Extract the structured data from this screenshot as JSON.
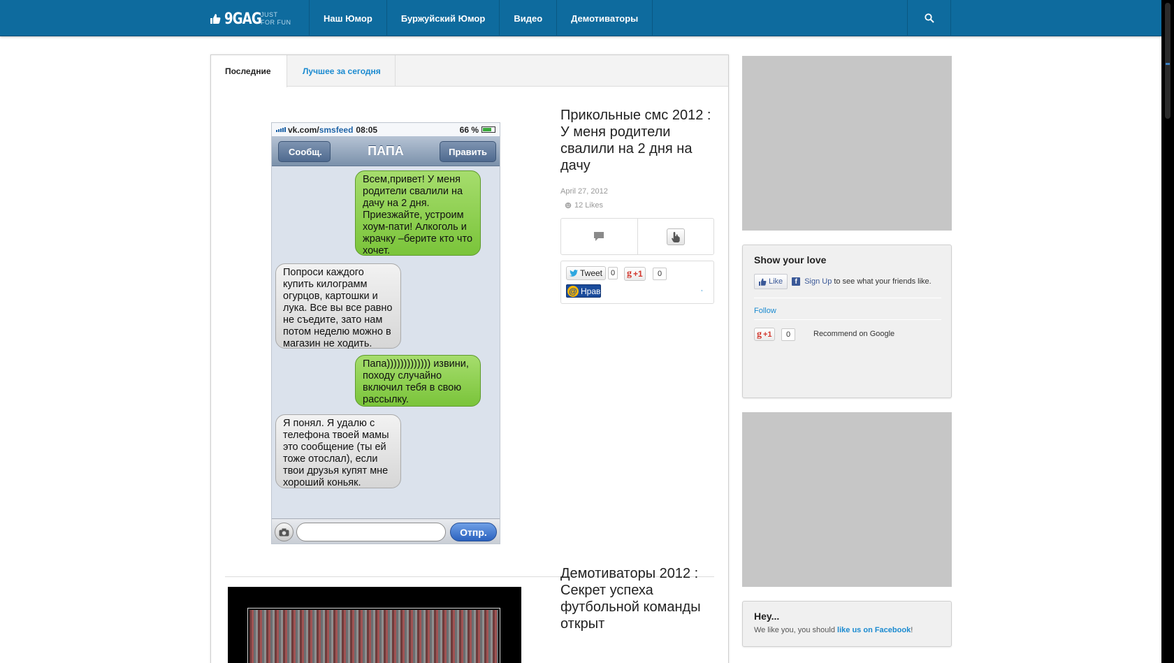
{
  "brand": {
    "logo": "9GAG",
    "tagline_1": "JUST",
    "tagline_2": "FOR FUN"
  },
  "nav": {
    "items": [
      "Наш Юмор",
      "Буржуйский Юмор",
      "Видео",
      "Демотиваторы"
    ]
  },
  "tabs": [
    {
      "label": "Последние",
      "active": true
    },
    {
      "label": "Лучшее за сегодня",
      "active": false
    }
  ],
  "posts": [
    {
      "title": "Прикольные смс 2012 : У меня родители свалили на 2 дня на дачу",
      "date": "April 27, 2012",
      "likes": "12 Likes",
      "share": {
        "tweet_label": "Tweet",
        "tweet_count": "0",
        "gplus_label": "+1",
        "gplus_count": "0",
        "mailru_label": "Нрав",
        "mark": ","
      },
      "image": {
        "status_site": "vk.com/",
        "status_site_accent": "smsfeed",
        "status_time": "08:05",
        "status_battery": "66 %",
        "back_label": "Сообщ.",
        "contact": "ПАПА",
        "edit_label": "Править",
        "messages": [
          {
            "side": "out",
            "text": "Всем,привет! У меня родители свалили на дачу на 2 дня. Приезжайте, устроим хоум-пати! Алкоголь и жрачку –берите кто что хочет."
          },
          {
            "side": "in",
            "text": "Попроси каждого купить килограмм огурцов, картошки и лука. Все вы все равно не съедите, зато нам потом неделю можно в магазин не ходить."
          },
          {
            "side": "out",
            "text": "Папа))))))))))))) извини, походу случайно включил тебя в свою рассылку."
          },
          {
            "side": "in",
            "text": "Я понял. Я удалю с телефона твоей мамы это сообщение (ты ей тоже отослал), если твои друзья купят мне хороший коньяк."
          }
        ],
        "send_label": "Отпр."
      }
    },
    {
      "title": "Демотиваторы 2012 : Секрет успеха футбольной команды открыт"
    }
  ],
  "sidebar": {
    "love": {
      "title": "Show your love",
      "fb_like": "Like",
      "fb_signup": "Sign Up",
      "fb_signup_rest": "to see what your friends like.",
      "follow": "Follow",
      "gplus_label": "+1",
      "gplus_count": "0",
      "recommend": "Recommend on Google"
    },
    "hey": {
      "title": "Hey...",
      "text_prefix": "We like you, you should",
      "link": "like us on Facebook",
      "text_suffix": "!"
    }
  },
  "colors": {
    "topbar": "#0e6b9e",
    "link": "#1a8ad0",
    "ad_placeholder": "#c6c6c6"
  }
}
